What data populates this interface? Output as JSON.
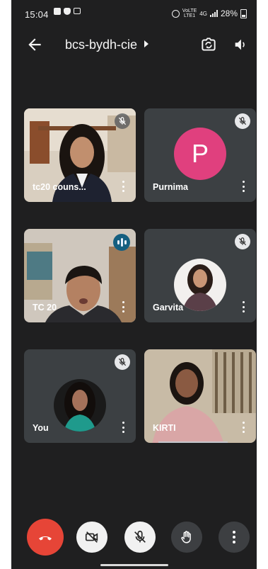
{
  "status_bar": {
    "time": "15:04",
    "network_top": "VoLTE",
    "network_mid": "LTE1",
    "network_gen": "4G",
    "battery": "28%"
  },
  "meeting": {
    "title": "bcs-bydh-cie"
  },
  "participants": [
    {
      "name": "tc20 couns...",
      "muted": true,
      "type": "video"
    },
    {
      "name": "Purnima",
      "initial": "P",
      "muted": true,
      "type": "initial",
      "avatar_color": "#e0407e"
    },
    {
      "name": "TC 20",
      "muted": false,
      "speaking": true,
      "type": "video"
    },
    {
      "name": "Garvita",
      "muted": true,
      "type": "photo"
    },
    {
      "name": "You",
      "muted": true,
      "type": "photo"
    },
    {
      "name": "KIRTI",
      "muted": false,
      "type": "video"
    }
  ],
  "colors": {
    "background": "#1f1f20",
    "tile": "#3c4043",
    "end_call": "#e64537",
    "speaking": "#155f80"
  },
  "icons": [
    "back-arrow-icon",
    "switch-camera-icon",
    "speaker-icon",
    "mic-off-icon",
    "speaking-indicator-icon",
    "more-vert-icon",
    "end-call-icon",
    "camera-off-icon",
    "raise-hand-icon"
  ]
}
